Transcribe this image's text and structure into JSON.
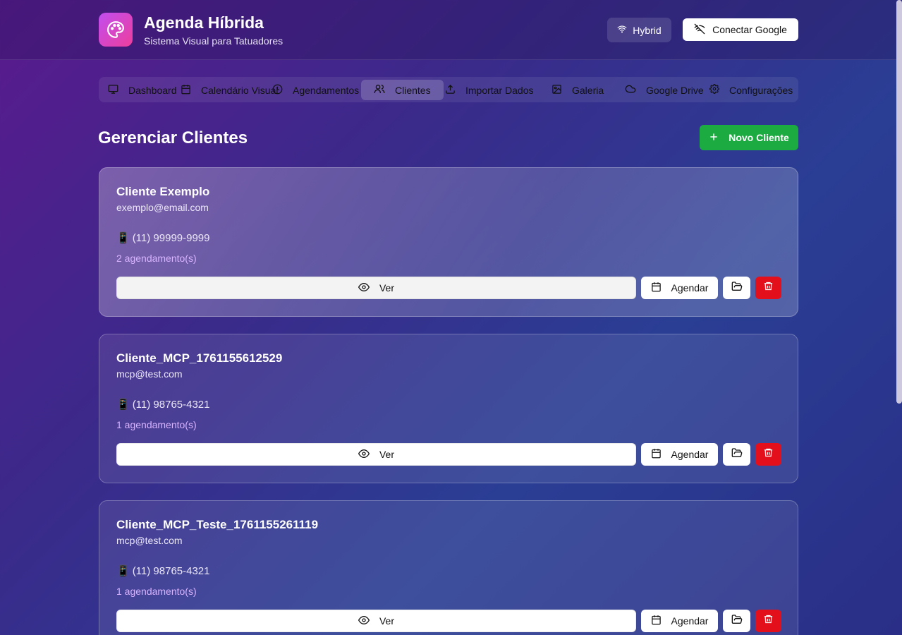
{
  "header": {
    "title": "Agenda Híbrida",
    "subtitle": "Sistema Visual para Tatuadores",
    "mode_label": "Hybrid",
    "google_button": "Conectar Google"
  },
  "nav": {
    "tabs": [
      {
        "label": "Dashboard",
        "icon": "monitor-icon"
      },
      {
        "label": "Calendário Visual",
        "icon": "calendar-icon"
      },
      {
        "label": "Agendamentos",
        "icon": "clock-icon"
      },
      {
        "label": "Clientes",
        "icon": "users-icon",
        "active": true
      },
      {
        "label": "Importar Dados",
        "icon": "upload-icon"
      },
      {
        "label": "Galeria",
        "icon": "image-icon"
      },
      {
        "label": "Google Drive",
        "icon": "cloud-icon"
      },
      {
        "label": "Configurações",
        "icon": "gear-icon"
      }
    ]
  },
  "page": {
    "title": "Gerenciar Clientes",
    "new_client_button": "Novo Cliente"
  },
  "clients": [
    {
      "name": "Cliente Exemplo",
      "email": "exemplo@email.com",
      "phone": "(11) 99999-9999",
      "appointments": "2 agendamento(s)"
    },
    {
      "name": "Cliente_MCP_1761155612529",
      "email": "mcp@test.com",
      "phone": "(11) 98765-4321",
      "appointments": "1 agendamento(s)"
    },
    {
      "name": "Cliente_MCP_Teste_1761155261119",
      "email": "mcp@test.com",
      "phone": "(11) 98765-4321",
      "appointments": "1 agendamento(s)"
    }
  ],
  "card_actions": {
    "view_label": "Ver",
    "schedule_label": "Agendar"
  },
  "colors": {
    "accent_green": "#1bab41",
    "danger_red": "#e3101c",
    "appointments_text": "#d9b4ff"
  }
}
